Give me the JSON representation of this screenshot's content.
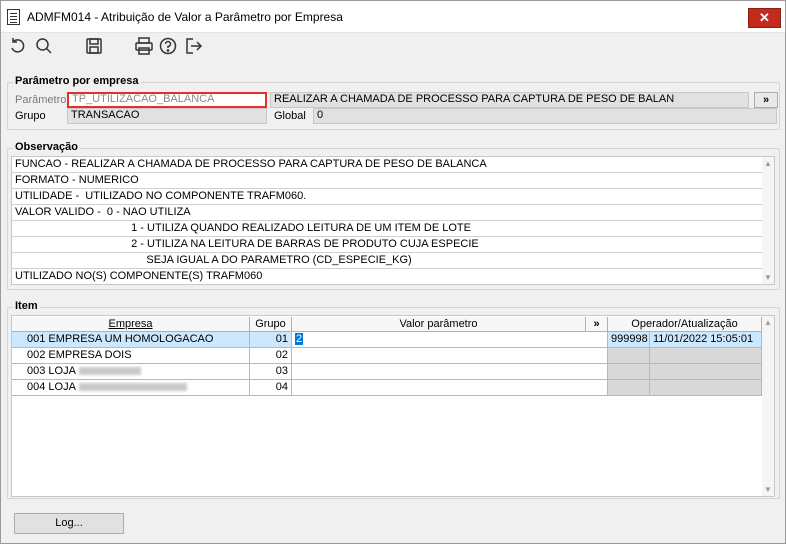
{
  "window": {
    "title": "ADMFM014 - Atribuição de Valor a Parâmetro por Empresa",
    "close_label": "✕"
  },
  "toolbar": {
    "icons": [
      "undo-icon",
      "search-icon",
      "save-icon",
      "print-icon",
      "help-icon",
      "exit-icon"
    ]
  },
  "parametro_section": {
    "legend": "Parâmetro por empresa",
    "parametro_label": "Parâmetro",
    "parametro_value": "TP_UTILIZACAO_BALANCA",
    "parametro_desc": "REALIZAR A CHAMADA DE PROCESSO PARA CAPTURA DE PESO DE BALAN",
    "expand_label": "»",
    "grupo_label": "Grupo",
    "grupo_value": "TRANSACAO",
    "global_label": "Global",
    "global_value": "0"
  },
  "observacao": {
    "legend": "Observação",
    "lines": [
      "FUNCAO - REALIZAR A CHAMADA DE PROCESSO PARA CAPTURA DE PESO DE BALANCA",
      "FORMATO - NUMERICO",
      "UTILIDADE -  UTILIZADO NO COMPONENTE TRAFM060.",
      "VALOR VALIDO -  0 - NAO UTILIZA",
      "                                      1 - UTILIZA QUANDO REALIZADO LEITURA DE UM ITEM DE LOTE",
      "                                      2 - UTILIZA NA LEITURA DE BARRAS DE PRODUTO CUJA ESPECIE",
      "                                           SEJA IGUAL A DO PARAMETRO (CD_ESPECIE_KG)",
      "UTILIZADO NO(S) COMPONENTE(S) TRAFM060"
    ]
  },
  "item_section": {
    "legend": "Item",
    "columns": {
      "empresa": "Empresa",
      "grupo": "Grupo",
      "valor": "Valor parâmetro",
      "expand": "»",
      "operador": "Operador/Atualização"
    },
    "rows": [
      {
        "code": "001",
        "empresa": "EMPRESA UM HOMOLOGACAO",
        "grupo": "01",
        "valor": "2",
        "operador": "999998",
        "atualizacao": "11/01/2022 15:05:01"
      },
      {
        "code": "002",
        "empresa": "EMPRESA DOIS",
        "grupo": "02",
        "valor": "",
        "operador": "",
        "atualizacao": ""
      },
      {
        "code": "003",
        "empresa": "LOJA",
        "grupo": "03",
        "valor": "",
        "operador": "",
        "atualizacao": ""
      },
      {
        "code": "004",
        "empresa": "LOJA",
        "grupo": "04",
        "valor": "",
        "operador": "",
        "atualizacao": ""
      }
    ]
  },
  "footer": {
    "log_label": "Log..."
  }
}
